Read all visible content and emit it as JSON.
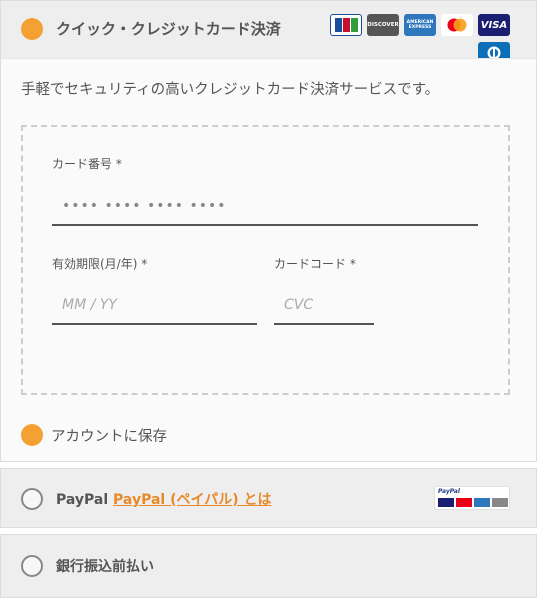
{
  "quick_card": {
    "title": "クイック・クレジットカード決済",
    "card_brands": [
      {
        "name": "JCB",
        "label": "JCB",
        "color": "#1a4c9c"
      },
      {
        "name": "Discover",
        "label": "DISCOVER",
        "color": "#555555"
      },
      {
        "name": "American Express",
        "label": "AMERICAN EXPRESS",
        "color": "#2e77bc"
      },
      {
        "name": "Mastercard",
        "label": "",
        "color": "#ffffff"
      },
      {
        "name": "Visa",
        "label": "VISA",
        "color": "#1a1f71"
      },
      {
        "name": "Diners Club",
        "label": "",
        "color": "#0a6fb8"
      }
    ],
    "description": "手軽でセキュリティの高いクレジットカード決済サービスです。",
    "card_number_label": "カード番号 *",
    "card_number_placeholder": "•••• •••• •••• ••••",
    "expiry_label": "有効期限(月/年) *",
    "expiry_placeholder": "MM / YY",
    "cvc_label": "カードコード *",
    "cvc_placeholder": "CVC",
    "save_account_label": "アカウントに保存"
  },
  "paypal": {
    "label": "PayPal",
    "link_text": "PayPal (ペイパル) とは"
  },
  "bank_transfer": {
    "label": "銀行振込前払い"
  },
  "colors": {
    "accent": "#f4a033",
    "link": "#e8892a"
  }
}
